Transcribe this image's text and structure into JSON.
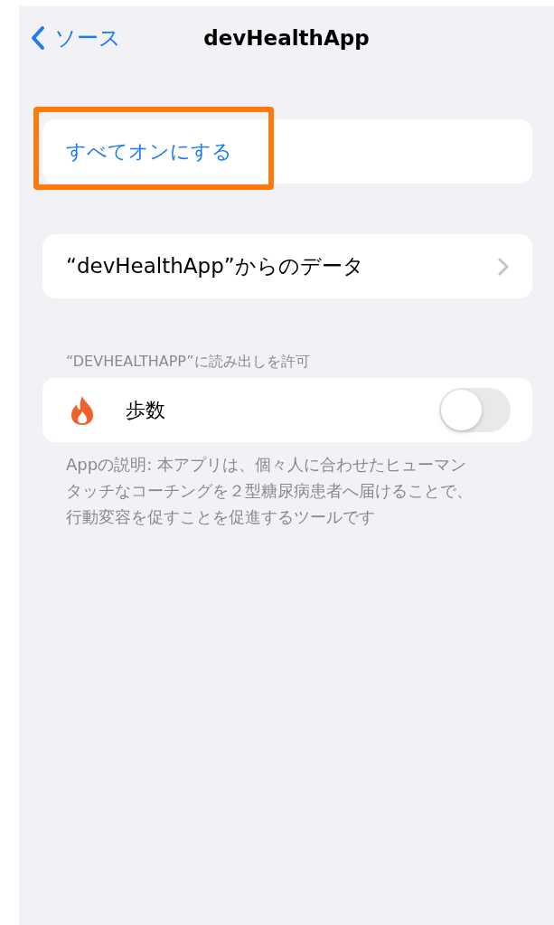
{
  "nav_bar": {
    "back_label": "ソース",
    "title": "devHealthApp"
  },
  "turn_all_on": {
    "label": "すべてオンにする",
    "highlighted": true
  },
  "data_link": {
    "label": "“devHealthApp”からのデータ"
  },
  "read_section": {
    "header": "“DEVHEALTHAPP”に読み出しを許可",
    "items": [
      {
        "label": "歩数",
        "on": false
      }
    ]
  },
  "description_lines": [
    "Appの説明: 本アプリは、個々人に合わせたヒューマン",
    "タッチなコーチングを２型糖尿病患者へ届けることで、",
    "行動変容を促すことを促進するツールです"
  ]
}
